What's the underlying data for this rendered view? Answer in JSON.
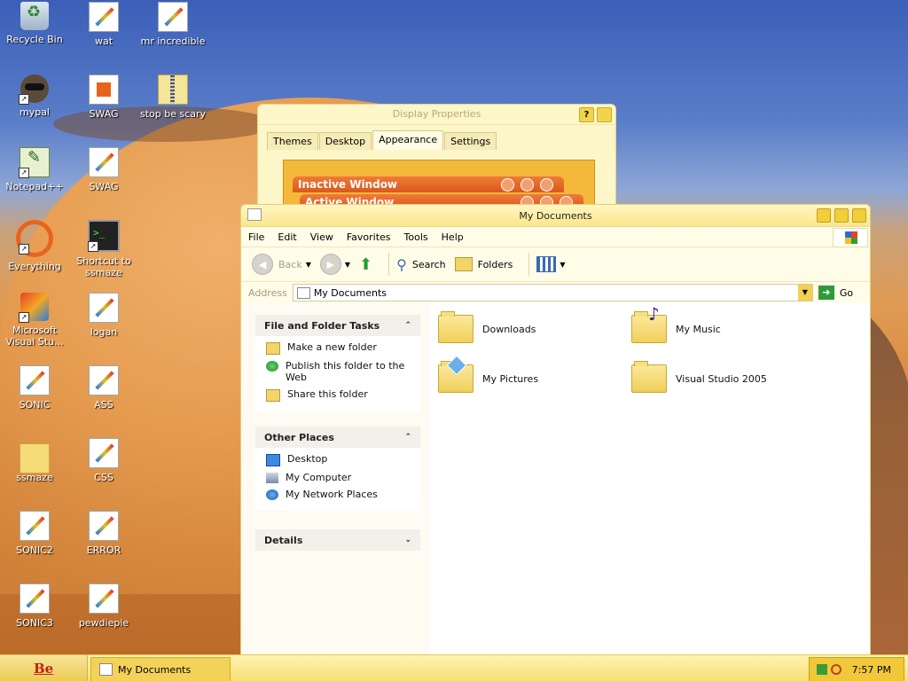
{
  "desktop": {
    "icons": [
      {
        "label": "Recycle Bin"
      },
      {
        "label": "wat"
      },
      {
        "label": "mr incredible"
      },
      {
        "label": "mypal"
      },
      {
        "label": "SWAG"
      },
      {
        "label": "stop be scary"
      },
      {
        "label": "Notepad++"
      },
      {
        "label": "SWAG"
      },
      {
        "label": "Everything"
      },
      {
        "label": "Shortcut to ssmaze"
      },
      {
        "label": "Microsoft Visual Stu..."
      },
      {
        "label": "logan"
      },
      {
        "label": "SONIC"
      },
      {
        "label": "ASS"
      },
      {
        "label": "ssmaze"
      },
      {
        "label": "CSS"
      },
      {
        "label": "SONIC2"
      },
      {
        "label": "ERROR"
      },
      {
        "label": "SONIC3"
      },
      {
        "label": "pewdiepie"
      }
    ]
  },
  "display_properties": {
    "title": "Display Properties",
    "help_button": "?",
    "tabs": [
      "Themes",
      "Desktop",
      "Appearance",
      "Settings"
    ],
    "active_tab": "Appearance",
    "preview_inactive": "Inactive Window",
    "preview_active": "Active Window"
  },
  "explorer": {
    "title": "My Documents",
    "menu": [
      "File",
      "Edit",
      "View",
      "Favorites",
      "Tools",
      "Help"
    ],
    "toolbar": {
      "back": "Back",
      "search": "Search",
      "folders": "Folders"
    },
    "address": {
      "label": "Address",
      "value": "My Documents",
      "go": "Go"
    },
    "tasks_panel": {
      "title": "File and Folder Tasks",
      "items": [
        "Make a new folder",
        "Publish this folder to the Web",
        "Share this folder"
      ]
    },
    "places_panel": {
      "title": "Other Places",
      "items": [
        "Desktop",
        "My Computer",
        "My Network Places"
      ]
    },
    "details_panel": {
      "title": "Details"
    },
    "folders": [
      {
        "name": "Downloads"
      },
      {
        "name": "My Music"
      },
      {
        "name": "My Pictures"
      },
      {
        "name": "Visual Studio 2005"
      }
    ]
  },
  "taskbar": {
    "start_label": "Be",
    "task_label": "My Documents",
    "clock": "7:57 PM"
  }
}
